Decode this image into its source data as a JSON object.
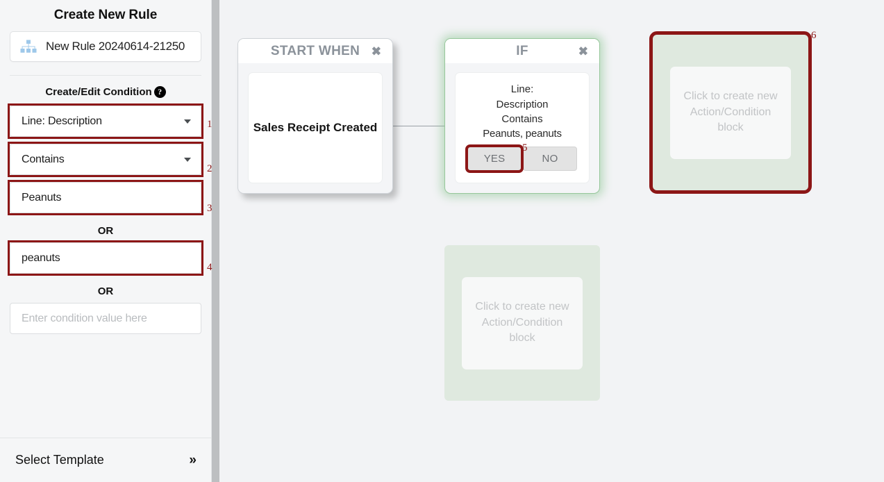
{
  "sidebar": {
    "title": "Create New Rule",
    "rule_name": {
      "icon": "sitemap-icon",
      "value": "New Rule 20240614-21250"
    },
    "section_title": "Create/Edit Condition",
    "help_icon_glyph": "?",
    "field_label": "Line: Description",
    "operator_label": "Contains",
    "condition_values": [
      {
        "value": "Peanuts",
        "placeholder": "Enter condition value here"
      },
      {
        "value": "peanuts",
        "placeholder": "Enter condition value here"
      },
      {
        "value": "",
        "placeholder": "Enter condition value here"
      }
    ],
    "or_label": "OR",
    "footer": {
      "label": "Select Template",
      "chevron": "»"
    }
  },
  "canvas": {
    "blocks": [
      {
        "id": "start-when",
        "header": "START WHEN",
        "close_glyph": "✖",
        "body_text": "Sales Receipt Created"
      },
      {
        "id": "if",
        "header": "IF",
        "close_glyph": "✖",
        "condition_line_1": "Line:",
        "condition_line_2": "Description",
        "condition_line_3": "Contains",
        "condition_line_4": "Peanuts, peanuts",
        "yes_label": "YES",
        "no_label": "NO"
      }
    ],
    "dropzones": [
      {
        "id": "dropzone-top-right",
        "text": "Click to create new Action/Condition block"
      },
      {
        "id": "dropzone-bottom",
        "text": "Click to create new Action/Condition block"
      }
    ]
  },
  "annotations": [
    {
      "n": "1"
    },
    {
      "n": "2"
    },
    {
      "n": "3"
    },
    {
      "n": "4"
    },
    {
      "n": "5"
    },
    {
      "n": "6"
    }
  ],
  "colors": {
    "annotation": "#8c1616",
    "highlight_border": "#8c1616",
    "canvas_bg": "#f2f3f5",
    "sidebar_bg": "#f5f6f7",
    "if_block_border": "#96c79a",
    "dropzone_bg": "#dfe9df",
    "icon_blue": "#9ec8ea"
  }
}
